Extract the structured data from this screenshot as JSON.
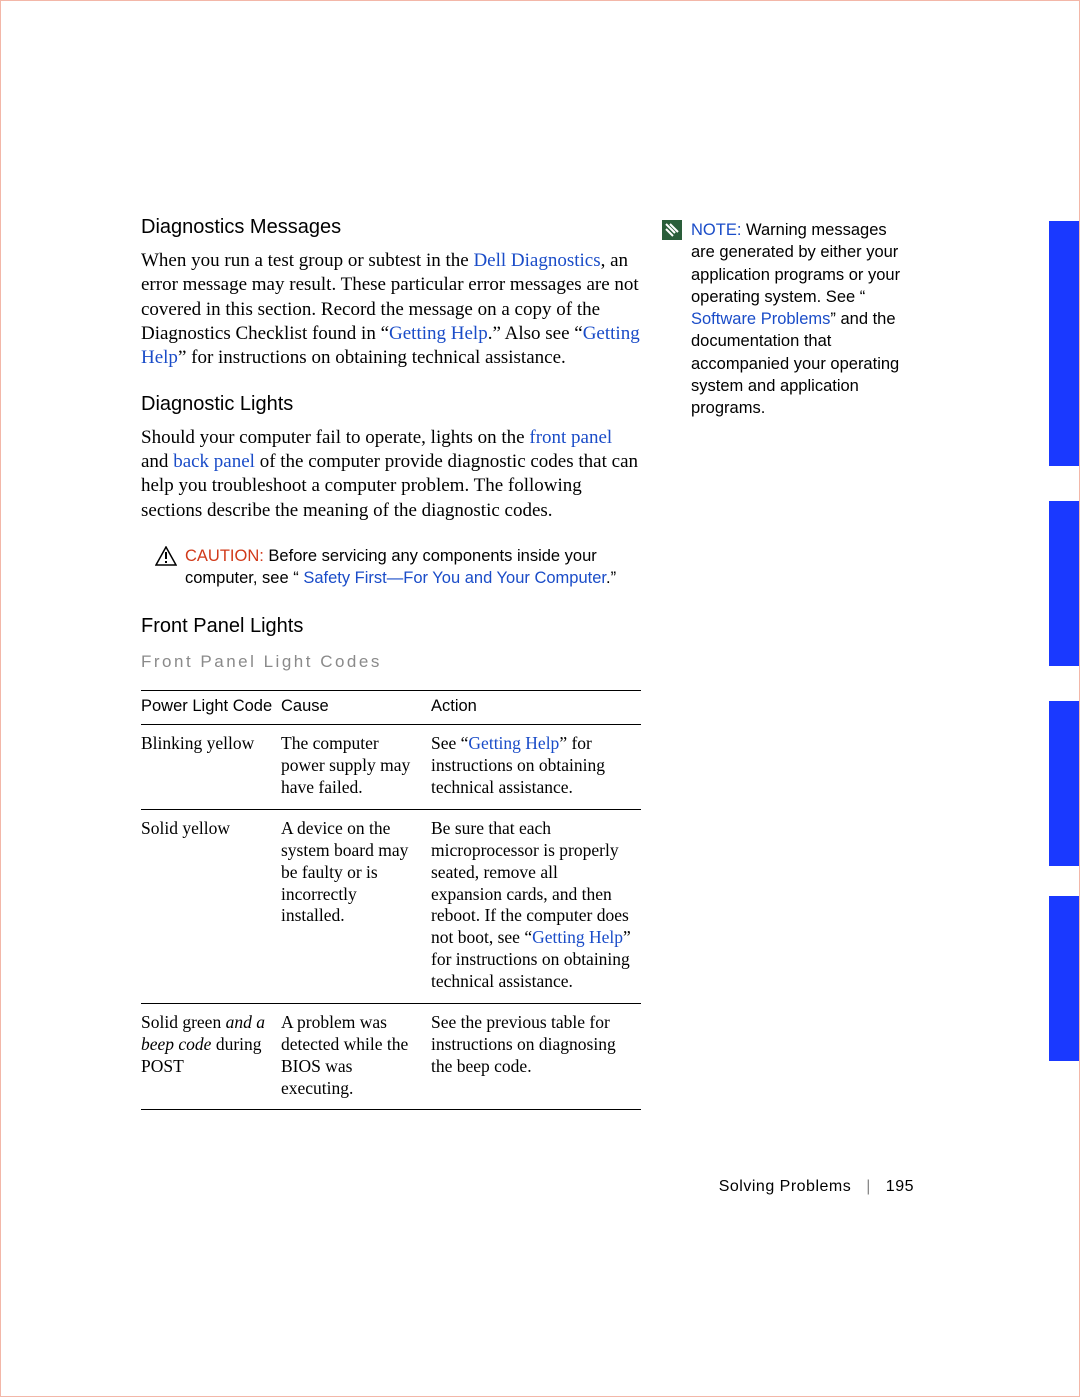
{
  "headings": {
    "diag_msg": "Diagnostics Messages",
    "diag_lights": "Diagnostic Lights",
    "fpl": "Front Panel Lights",
    "fpl_sub": "Front Panel Light Codes"
  },
  "diag_msg_para": {
    "t1": "When you run a test group or subtest in the ",
    "l1": "Dell Diagnostics",
    "t2": ", an error message may result. These particular error messages are not covered in this section. Record the message on a copy of the Diagnostics Checklist found in “",
    "l2": "Getting Help",
    "t3": ".” Also see “",
    "l3": "Getting Help",
    "t4": "” for instructions on obtaining technical assistance."
  },
  "diag_lights_para": {
    "t1": "Should your computer fail to operate, lights on the ",
    "l1": "front panel",
    "t2": " and ",
    "l2": "back panel",
    "t3": " of the computer provide diagnostic codes that can help you troubleshoot a computer problem. The following sections describe the meaning of the diagnostic codes."
  },
  "caution": {
    "label": "CAUTION:",
    "t1": " Before servicing any components inside your computer, see “ ",
    "l1": "Safety First—For You and Your Computer",
    "t2": ".”"
  },
  "table": {
    "h1": "Power Light Code",
    "h2": "Cause",
    "h3": "Action",
    "rows": [
      {
        "code": "Blinking yellow",
        "cause": "The computer power supply may have failed.",
        "action_t1": "See “",
        "action_l1": "Getting Help",
        "action_t2": "” for instructions on obtaining technical assistance."
      },
      {
        "code": "Solid yellow",
        "cause": "A device on the system board may be faulty or is incorrectly installed.",
        "action_t1": "Be sure that each microprocessor is properly seated, remove all expansion cards, and then reboot. If the computer does not boot, see “",
        "action_l1": "Getting Help",
        "action_t2": "” for instructions on obtaining technical assistance."
      },
      {
        "code_pre": "Solid green ",
        "code_em": "and a beep code",
        "code_post": " during POST",
        "cause": "A problem was detected while the BIOS was executing.",
        "action": "See the previous table for instructions on diagnosing the beep code."
      }
    ]
  },
  "note": {
    "label": "NOTE:",
    "t1": " Warning messages are generated by either your application programs or your operating system. See “ ",
    "l1": "Software Problems",
    "t2": "” and the documentation that accompanied your operating system and application programs."
  },
  "footer": {
    "section": "Solving Problems",
    "page": "195"
  }
}
